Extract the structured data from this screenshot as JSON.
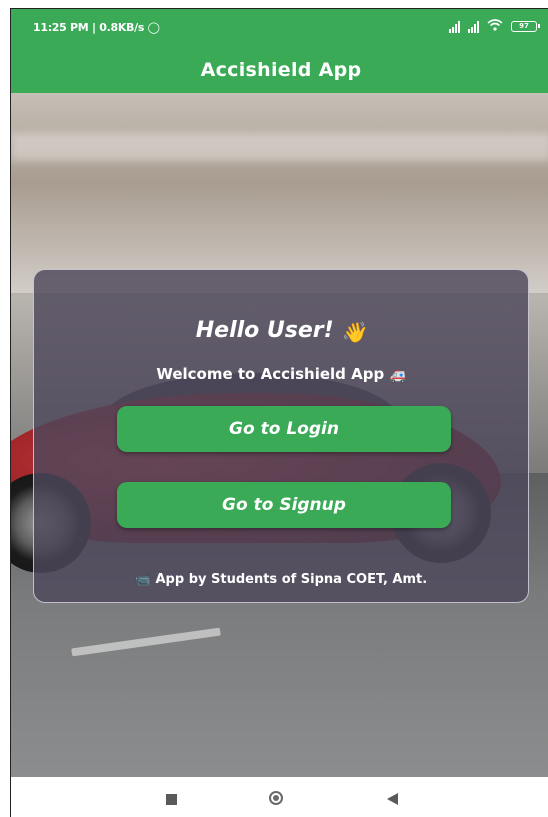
{
  "status_bar": {
    "time_info": "11:25 PM | 0.8KB/s",
    "battery": "97"
  },
  "app_bar": {
    "title": "Accishield App"
  },
  "card": {
    "greeting": "Hello User!",
    "greeting_emoji": "👋",
    "welcome": "Welcome to Accishield App",
    "welcome_emoji": "🚑",
    "login_button": "Go to Login",
    "signup_button": "Go to Signup",
    "credit_emoji": "📹",
    "credit": "App by Students of Sipna COET, Amt."
  },
  "colors": {
    "accent": "#3aaa57",
    "card_bg": "#4e485c"
  },
  "icons": {
    "status": [
      "alarm-icon",
      "signal-icon",
      "wifi-icon",
      "battery-icon"
    ],
    "nav": [
      "recent-apps-icon",
      "home-icon",
      "back-icon"
    ]
  }
}
